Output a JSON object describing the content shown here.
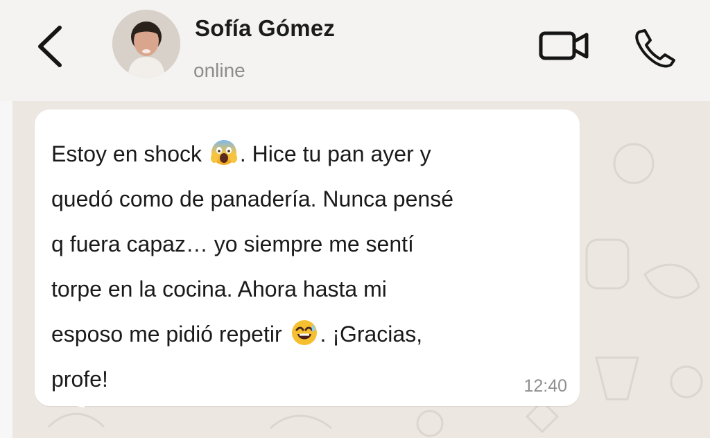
{
  "header": {
    "contact_name": "Sofía Gómez",
    "status": "online",
    "icons": {
      "back": "chevron-left-icon",
      "video": "video-camera-icon",
      "phone": "phone-icon"
    }
  },
  "message": {
    "parts": [
      "Estoy en shock ",
      ". Hice tu pan ayer y\nquedó como de panadería. Nunca pensé\nq fuera capaz… yo siempre me sentí\ntorpe en la cocina. Ahora hasta mi\nesposo me pidió repetir ",
      ". ¡Gracias,\nprofe!"
    ],
    "emojis": [
      "face-screaming-in-fear-emoji",
      "grinning-face-with-sweat-emoji"
    ],
    "time": "12:40"
  },
  "colors": {
    "header_bg": "#f4f3f1",
    "chat_bg": "#ece7e0",
    "bubble_bg": "#ffffff",
    "text": "#1a1a1a",
    "muted": "#8d8d8d"
  }
}
